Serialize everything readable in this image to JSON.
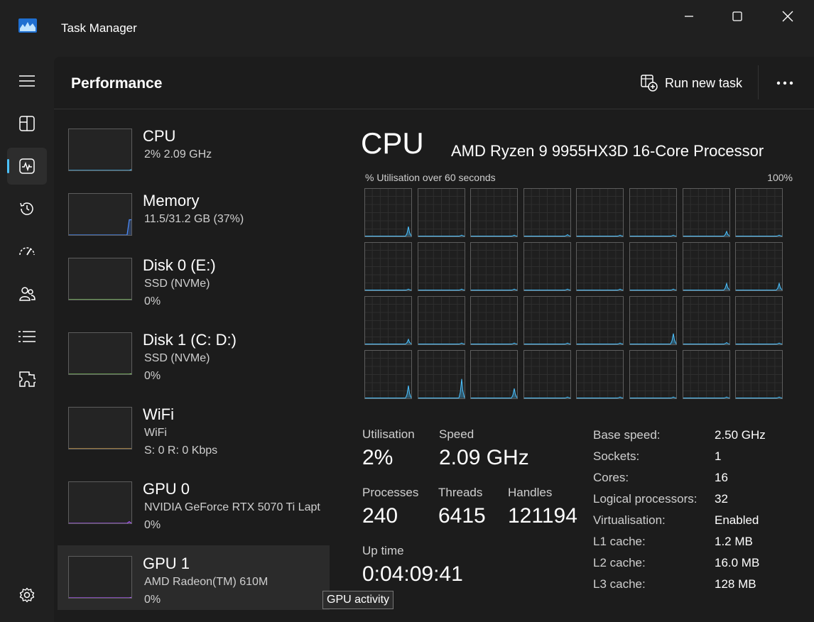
{
  "window": {
    "title": "Task Manager",
    "controls": [
      "minimize",
      "maximize",
      "close"
    ]
  },
  "nav": {
    "items": [
      {
        "icon": "hamburger-menu-icon"
      },
      {
        "icon": "processes-icon"
      },
      {
        "icon": "performance-icon",
        "active": true
      },
      {
        "icon": "app-history-icon"
      },
      {
        "icon": "startup-apps-icon"
      },
      {
        "icon": "users-icon"
      },
      {
        "icon": "details-icon"
      },
      {
        "icon": "services-icon"
      },
      {
        "icon": "settings-icon"
      }
    ]
  },
  "header": {
    "title": "Performance",
    "run_task_label": "Run new task",
    "more_icon": "more-options-icon"
  },
  "sidebar": {
    "items": [
      {
        "title": "CPU",
        "sub": "2%  2.09 GHz",
        "sub2": "",
        "selected": true,
        "color": "#4cc2ff",
        "spark": [
          0,
          0,
          0,
          0,
          0,
          0,
          0,
          0,
          0,
          0,
          0,
          0,
          0,
          0,
          0,
          0,
          0,
          0,
          0,
          0,
          0,
          0,
          0,
          0,
          0,
          0,
          0,
          0,
          0,
          2
        ]
      },
      {
        "title": "Memory",
        "sub": "11.5/31.2 GB (37%)",
        "sub2": "",
        "selected": false,
        "color": "#4c8dff",
        "spark": [
          0,
          0,
          0,
          0,
          0,
          0,
          0,
          0,
          0,
          0,
          0,
          0,
          0,
          0,
          0,
          0,
          0,
          0,
          0,
          0,
          0,
          0,
          0,
          0,
          0,
          0,
          0,
          0,
          37,
          37
        ]
      },
      {
        "title": "Disk 0 (E:)",
        "sub": "SSD (NVMe)",
        "sub2": "0%",
        "selected": false,
        "color": "#8bd36a",
        "spark": [
          0,
          0,
          0,
          0,
          0,
          0,
          0,
          0,
          0,
          0,
          0,
          0,
          0,
          0,
          0,
          0,
          0,
          0,
          0,
          0,
          0,
          0,
          0,
          0,
          0,
          0,
          0,
          0,
          0,
          0
        ]
      },
      {
        "title": "Disk 1 (C: D:)",
        "sub": "SSD (NVMe)",
        "sub2": "0%",
        "selected": false,
        "color": "#8bd36a",
        "spark": [
          0,
          0,
          0,
          0,
          0,
          0,
          0,
          0,
          0,
          0,
          0,
          0,
          0,
          0,
          0,
          0,
          0,
          0,
          0,
          0,
          0,
          0,
          0,
          0,
          0,
          0,
          0,
          0,
          0,
          1
        ]
      },
      {
        "title": "WiFi",
        "sub": "WiFi",
        "sub2": "S: 0  R: 0 Kbps",
        "selected": false,
        "color": "#d9a44c",
        "spark": [
          0,
          0,
          0,
          0,
          0,
          0,
          0,
          0,
          0,
          0,
          0,
          0,
          0,
          0,
          0,
          0,
          0,
          0,
          0,
          0,
          0,
          0,
          0,
          0,
          0,
          0,
          0,
          0,
          0,
          0
        ]
      },
      {
        "title": "GPU 0",
        "sub": "NVIDIA GeForce RTX 5070 Ti Lapt",
        "sub2": "0%",
        "selected": false,
        "color": "#b05cff",
        "spark": [
          0,
          0,
          0,
          0,
          0,
          0,
          0,
          0,
          0,
          0,
          0,
          0,
          0,
          0,
          0,
          0,
          0,
          0,
          0,
          0,
          0,
          0,
          0,
          0,
          0,
          0,
          0,
          0,
          4,
          0
        ]
      },
      {
        "title": "GPU 1",
        "sub": "AMD Radeon(TM) 610M",
        "sub2": "0%",
        "selected": true,
        "color": "#b05cff",
        "spark": [
          0,
          0,
          0,
          0,
          0,
          0,
          0,
          0,
          0,
          0,
          0,
          0,
          0,
          0,
          0,
          0,
          0,
          0,
          0,
          0,
          0,
          0,
          0,
          0,
          0,
          0,
          0,
          0,
          0,
          1
        ]
      }
    ]
  },
  "tooltip": "GPU activity",
  "cpu": {
    "heading": "CPU",
    "name": "AMD Ryzen 9 9955HX3D 16-Core Processor",
    "util_label": "% Utilisation over 60 seconds",
    "util_max": "100%",
    "graph_color": "#4cc2ff",
    "core_peaks": [
      20,
      2,
      2,
      3,
      2,
      2,
      10,
      2,
      2,
      2,
      2,
      2,
      2,
      2,
      14,
      14,
      10,
      2,
      2,
      2,
      2,
      22,
      3,
      2,
      26,
      40,
      20,
      2,
      2,
      2,
      2,
      2
    ],
    "stats": {
      "utilisation_label": "Utilisation",
      "utilisation_value": "2%",
      "speed_label": "Speed",
      "speed_value": "2.09 GHz",
      "processes_label": "Processes",
      "processes_value": "240",
      "threads_label": "Threads",
      "threads_value": "6415",
      "handles_label": "Handles",
      "handles_value": "121194",
      "uptime_label": "Up time",
      "uptime_value": "0:04:09:41"
    },
    "specs": [
      {
        "label": "Base speed:",
        "value": "2.50 GHz"
      },
      {
        "label": "Sockets:",
        "value": "1"
      },
      {
        "label": "Cores:",
        "value": "16"
      },
      {
        "label": "Logical processors:",
        "value": "32"
      },
      {
        "label": "Virtualisation:",
        "value": "Enabled"
      },
      {
        "label": "L1 cache:",
        "value": "1.2 MB"
      },
      {
        "label": "L2 cache:",
        "value": "16.0 MB"
      },
      {
        "label": "L3 cache:",
        "value": "128 MB"
      }
    ]
  }
}
